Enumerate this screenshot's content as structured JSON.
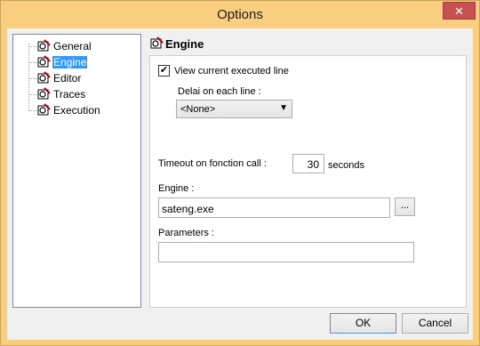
{
  "window": {
    "title": "Options",
    "close_label": "✕"
  },
  "tree": {
    "items": [
      {
        "label": "General"
      },
      {
        "label": "Engine"
      },
      {
        "label": "Editor"
      },
      {
        "label": "Traces"
      },
      {
        "label": "Execution"
      }
    ],
    "selected": "Engine"
  },
  "panel": {
    "title": "Engine",
    "view_executed_line": {
      "label": "View current executed line",
      "checked": true
    },
    "delay_label": "Delai on each line :",
    "delay_value": "<None>",
    "timeout_label": "Timeout on fonction call :",
    "timeout_value": "30",
    "timeout_unit": "seconds",
    "engine_label": "Engine :",
    "engine_value": "sateng.exe",
    "browse_label": "...",
    "parameters_label": "Parameters :",
    "parameters_value": ""
  },
  "buttons": {
    "ok": "OK",
    "cancel": "Cancel"
  },
  "colors": {
    "titlebar": "#f9cf7f",
    "selection": "#3399ff",
    "close": "#c75050"
  },
  "icons": {
    "tree_item": "gear-pencil-icon",
    "checkbox": "checkmark-icon",
    "dropdown": "chevron-down-icon"
  }
}
